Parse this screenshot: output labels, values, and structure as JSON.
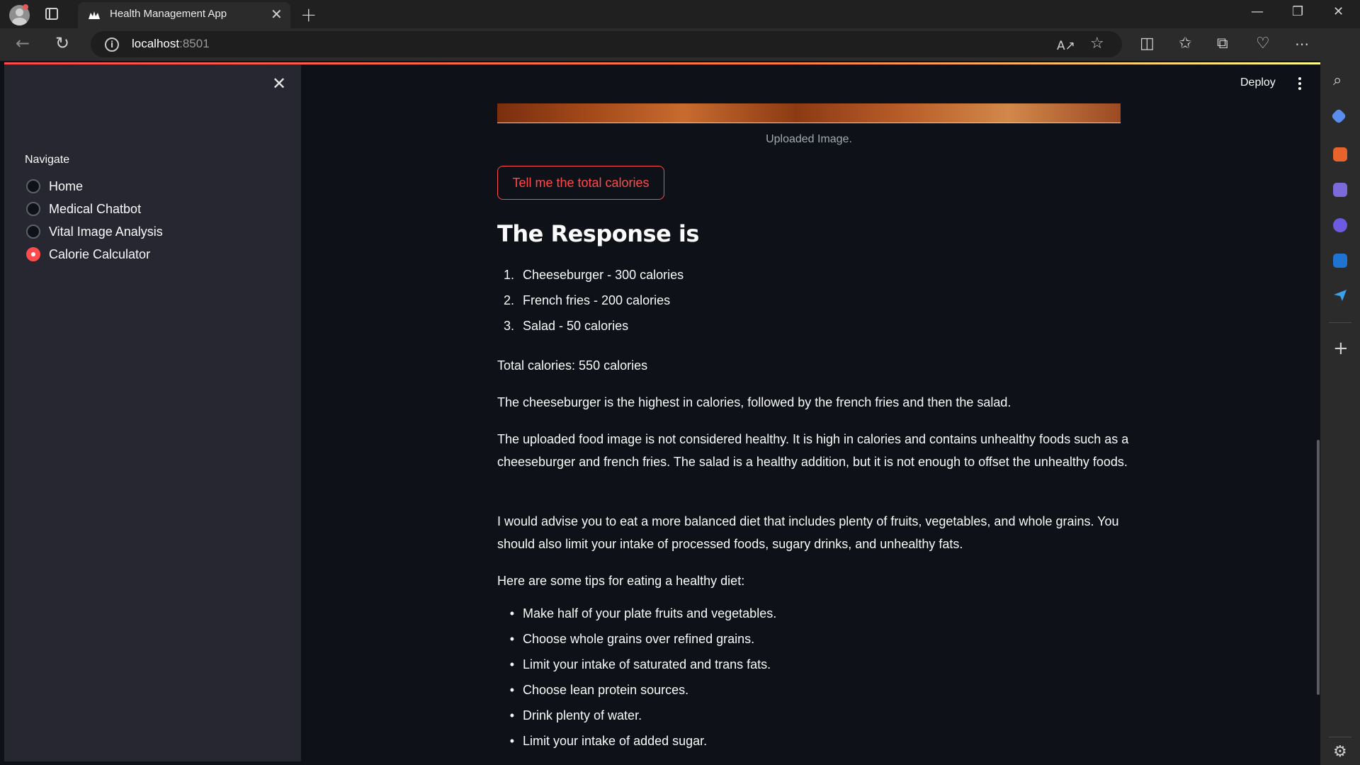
{
  "browser": {
    "tab_title": "Health Management App",
    "url_host": "localhost",
    "url_port": ":8501",
    "colors": {
      "accent": "#ff4b4b",
      "chrome": "#202020",
      "toolbar": "#2b2b2b"
    }
  },
  "sidebar": {
    "nav_label": "Navigate",
    "items": [
      {
        "label": "Home",
        "checked": false
      },
      {
        "label": "Medical Chatbot",
        "checked": false
      },
      {
        "label": "Vital Image Analysis",
        "checked": false
      },
      {
        "label": "Calorie Calculator",
        "checked": true
      }
    ]
  },
  "header": {
    "deploy_label": "Deploy"
  },
  "main": {
    "image_caption": "Uploaded Image.",
    "button_label": "Tell me the total calories",
    "response_title": "The Response is",
    "calorie_list": [
      {
        "num": "1.",
        "text": "Cheeseburger - 300 calories"
      },
      {
        "num": "2.",
        "text": "French fries - 200 calories"
      },
      {
        "num": "3.",
        "text": "Salad - 50 calories"
      }
    ],
    "total_text": "Total calories: 550 calories",
    "para_ranking": "The cheeseburger is the highest in calories, followed by the french fries and then the salad.",
    "para_health": "The uploaded food image is not considered healthy. It is high in calories and contains unhealthy foods such as a cheeseburger and french fries. The salad is a healthy addition, but it is not enough to offset the unhealthy foods.",
    "para_advice": "I would advise you to eat a more balanced diet that includes plenty of fruits, vegetables, and whole grains. You should also limit your intake of processed foods, sugary drinks, and unhealthy fats.",
    "tips_intro": "Here are some tips for eating a healthy diet:",
    "tips": [
      "Make half of your plate fruits and vegetables.",
      "Choose whole grains over refined grains.",
      "Limit your intake of saturated and trans fats.",
      "Choose lean protein sources.",
      "Drink plenty of water.",
      "Limit your intake of added sugar."
    ]
  }
}
